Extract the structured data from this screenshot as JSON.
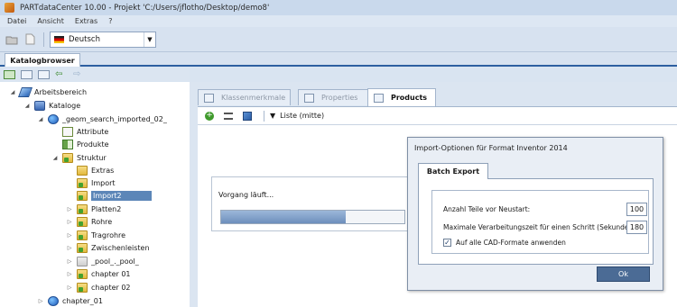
{
  "window": {
    "title": "PARTdataCenter 10.00 - Projekt 'C:/Users/jflotho/Desktop/demo8'"
  },
  "menu": {
    "items": [
      "Datei",
      "Ansicht",
      "Extras",
      "?"
    ]
  },
  "toolbar": {
    "language": "Deutsch"
  },
  "main_tab": {
    "label": "Katalogbrowser"
  },
  "tree": {
    "items": [
      {
        "label": "Arbeitsbereich",
        "icon": "workspace-icon"
      },
      {
        "label": "Kataloge",
        "icon": "catalogs-icon"
      },
      {
        "label": "_geom_search_imported_02_",
        "icon": "catalog-ball-icon"
      },
      {
        "label": "Attribute",
        "icon": "attribute-icon"
      },
      {
        "label": "Produkte",
        "icon": "products-icon"
      },
      {
        "label": "Struktur",
        "icon": "folder-icon"
      },
      {
        "label": "Extras",
        "icon": "folder-icon"
      },
      {
        "label": "Import",
        "icon": "folder-icon"
      },
      {
        "label": "Import2",
        "icon": "folder-icon",
        "selected": true
      },
      {
        "label": "Platten2",
        "icon": "folder-icon"
      },
      {
        "label": "Rohre",
        "icon": "folder-icon"
      },
      {
        "label": "Tragrohre",
        "icon": "folder-icon"
      },
      {
        "label": "Zwischenleisten",
        "icon": "folder-icon"
      },
      {
        "label": "_pool_._pool_",
        "icon": "folder-icon"
      },
      {
        "label": "chapter 01",
        "icon": "folder-icon"
      },
      {
        "label": "chapter 02",
        "icon": "folder-icon"
      },
      {
        "label": "chapter_01",
        "icon": "catalog-ball-icon"
      }
    ]
  },
  "panel_tabs": [
    {
      "label": "Klassenmerkmale",
      "active": false
    },
    {
      "label": "Properties",
      "active": false
    },
    {
      "label": "Products",
      "active": true
    }
  ],
  "panel_toolbar": {
    "view_label": "Liste (mitte)"
  },
  "progress": {
    "label": "Vorgang läuft...",
    "fraction": 0.68
  },
  "dialog": {
    "title": "Import-Optionen für Format Inventor 2014",
    "tab": "Batch Export",
    "fields": [
      {
        "label": "Anzahl Teile vor Neustart:",
        "value": "100"
      },
      {
        "label": "Maximale Verarbeitungszeit für einen Schritt (Sekunden):",
        "value": "180"
      }
    ],
    "checkbox": {
      "label": "Auf alle CAD-Formate anwenden",
      "checked": true
    },
    "ok": "Ok"
  }
}
